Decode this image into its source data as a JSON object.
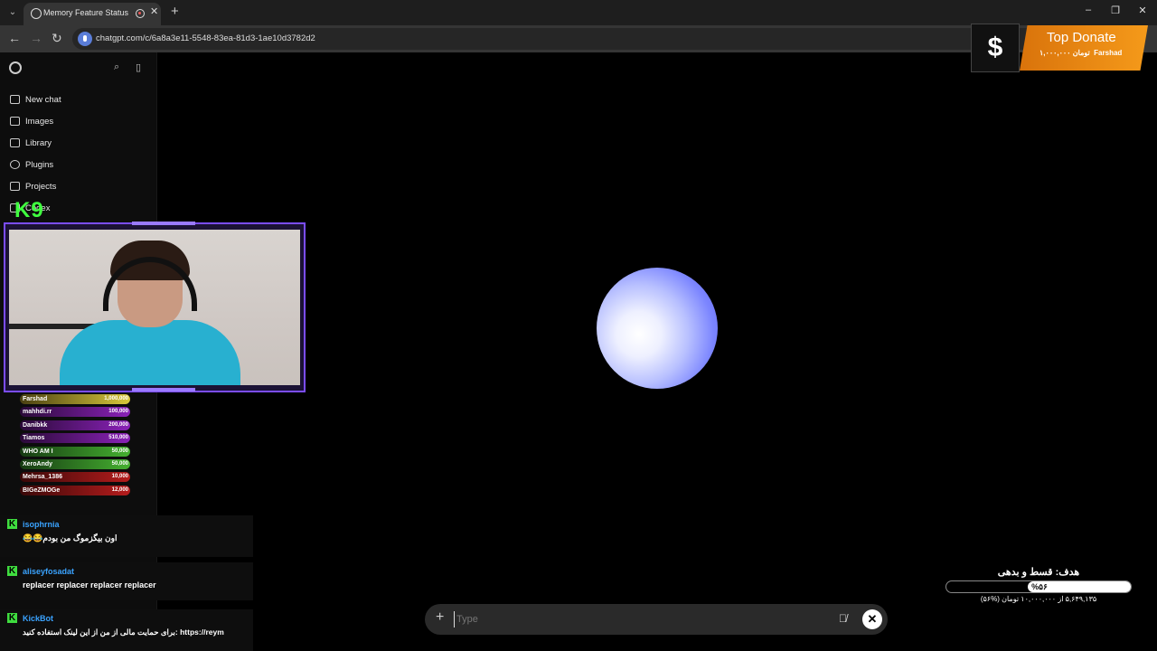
{
  "browser": {
    "tab_title": "Memory Feature Status",
    "new_tab_glyph": "+",
    "url": "chatgpt.com/c/6a8a3e11-5548-83ea-81d3-1ae10d3782d2",
    "window_controls": [
      "–",
      "❐",
      "✕"
    ]
  },
  "sidebar": {
    "items": [
      {
        "label": "New chat",
        "icon": "new-chat-icon"
      },
      {
        "label": "Images",
        "icon": "images-icon"
      },
      {
        "label": "Library",
        "icon": "library-icon"
      },
      {
        "label": "Plugins",
        "icon": "plugins-icon"
      },
      {
        "label": "Projects",
        "icon": "projects-icon"
      },
      {
        "label": "Codex",
        "icon": "codex-icon"
      }
    ]
  },
  "overlay": {
    "k9_logo": "K9",
    "donors": [
      {
        "name": "Farshad",
        "amount": "1,000,000",
        "color": "#c9b52a"
      },
      {
        "name": "mahhdi.rr",
        "amount": "100,000",
        "color": "#7a1aa0"
      },
      {
        "name": "Danibkk",
        "amount": "200,000",
        "color": "#7a1aa0"
      },
      {
        "name": "Tiamos",
        "amount": "510,000",
        "color": "#7a1aa0"
      },
      {
        "name": "WHO AM I",
        "amount": "50,000",
        "color": "#3c9b2a"
      },
      {
        "name": "XeroAndy",
        "amount": "50,000",
        "color": "#3c9b2a"
      },
      {
        "name": "Mehrsa_1386",
        "amount": "10,000",
        "color": "#a01818"
      },
      {
        "name": "BIGeZMOGe",
        "amount": "12,000",
        "color": "#a01818"
      }
    ],
    "chat": [
      {
        "user": "isophrnia",
        "text": "😂😂اون بیگزموگ من بودم"
      },
      {
        "user": "aliseyfosadat",
        "text": "replacer replacer replacer replacer"
      },
      {
        "user": "KickBot",
        "text": "برای حمایت مالی از من از این لینک استفاده کنید: https://reym"
      }
    ],
    "top_donate": {
      "logo": "$",
      "title": "Top Donate",
      "donor": "Farshad",
      "amount": "۱,۰۰۰,۰۰۰ تومان"
    },
    "goal": {
      "title": "هدف: قسط و بدهی",
      "percent_label": "%۵۶",
      "percent": 56,
      "summary": "۵,۶۴۹,۱۳۵ از ۱۰,۰۰۰,۰۰۰ تومان (%۵۶)"
    }
  },
  "composer": {
    "placeholder": "Type"
  }
}
